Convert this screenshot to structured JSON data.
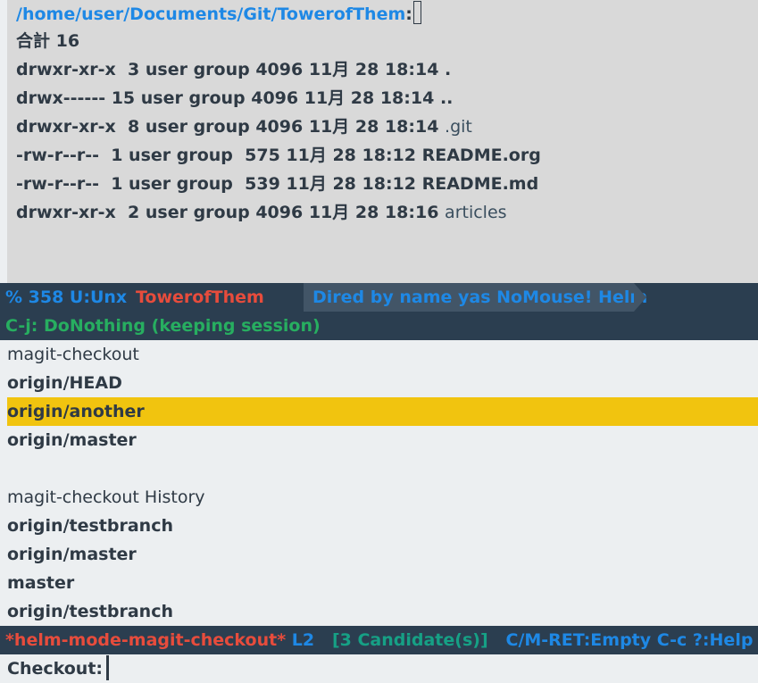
{
  "dired": {
    "path": "/home/user/Documents/Git/TowerofThem",
    "path_suffix": ":",
    "total": "合計 16",
    "entries": [
      {
        "meta": "drwxr-xr-x  3 user group 4096 11月 28 18:14 ",
        "name": "."
      },
      {
        "meta": "drwx------ 15 user group 4096 11月 28 18:14 ",
        "name": ".."
      },
      {
        "meta": "drwxr-xr-x  8 user group 4096 11月 28 18:14 ",
        "name": ".git"
      },
      {
        "meta": "-rw-r--r--  1 user group  575 11月 28 18:12 ",
        "name": "README.org"
      },
      {
        "meta": "-rw-r--r--  1 user group  539 11月 28 18:12 ",
        "name": "README.md"
      },
      {
        "meta": "drwxr-xr-x  2 user group 4096 11月 28 18:16 ",
        "name": "articles"
      }
    ]
  },
  "modeline_dired": {
    "position": "% 358 U:Unx",
    "buffer": "TowerofThem",
    "modes": "Dired by name yas NoMouse! Helm"
  },
  "helm_header": "C-j: DoNothing (keeping session)",
  "sources": [
    {
      "title": "magit-checkout",
      "candidates": [
        "origin/HEAD",
        "origin/another",
        "origin/master"
      ],
      "selected_index": 1
    },
    {
      "title": "magit-checkout History",
      "candidates": [
        "origin/testbranch",
        "origin/master",
        "master",
        "origin/testbranch"
      ]
    }
  ],
  "modeline_helm": {
    "buffer": "*helm-mode-magit-checkout*",
    "line": "L2",
    "candidates": "[3 Candidate(s)]",
    "help": "C/M-RET:Empty C-c ?:Help TA"
  },
  "minibuffer": {
    "prompt": "Checkout:",
    "input": ""
  },
  "colors": {
    "path": "#1e88e5",
    "modeline_bg": "#2b3e50",
    "selection": "#f1c40f",
    "buffer_name": "#e74c3c",
    "header_text": "#27ae60"
  }
}
